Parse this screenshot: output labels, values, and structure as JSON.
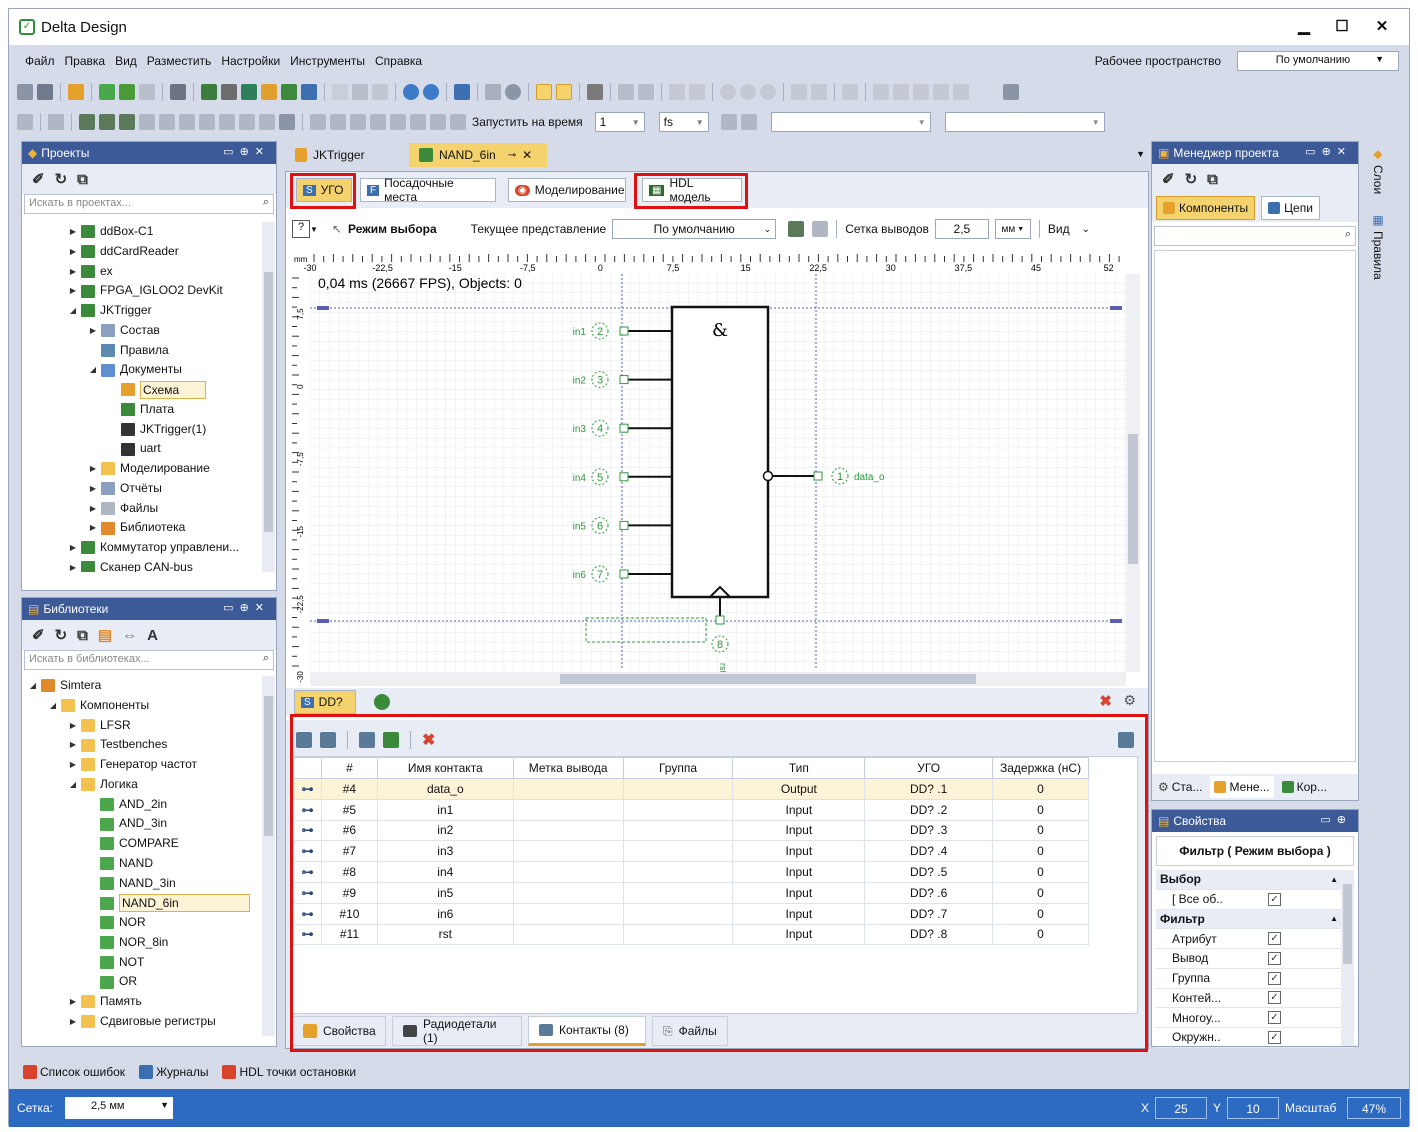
{
  "app": {
    "title": "Delta Design"
  },
  "menu": [
    "Файл",
    "Правка",
    "Вид",
    "Разместить",
    "Настройки",
    "Инструменты",
    "Справка"
  ],
  "workspace": {
    "label": "Рабочее пространство",
    "value": "По умолчанию"
  },
  "toolbar3": {
    "run_label": "Запустить на время",
    "run_value": "1",
    "run_unit": "fs"
  },
  "projects": {
    "title": "Проекты",
    "search_placeholder": "Искать в проектах...",
    "items": [
      "ddBox-C1",
      "ddCardReader",
      "ex",
      "FPGA_IGLOO2 DevKit",
      "JKTrigger",
      "Состав",
      "Правила",
      "Документы",
      "Схема",
      "Плата",
      "JKTrigger(1)",
      "uart",
      "Моделирование",
      "Отчёты",
      "Файлы",
      "Библиотека",
      "Коммутатор управлени...",
      "Сканер CAN-bus"
    ]
  },
  "libraries": {
    "title": "Библиотеки",
    "search_placeholder": "Искать в библиотеках...",
    "items": [
      "Simtera",
      "Компоненты",
      "LFSR",
      "Testbenches",
      "Генератор частот",
      "Логика",
      "AND_2in",
      "AND_3in",
      "COMPARE",
      "NAND",
      "NAND_3in",
      "NAND_6in",
      "NOR",
      "NOR_8in",
      "NOT",
      "OR",
      "Память",
      "Сдвиговые регистры"
    ]
  },
  "doc_tabs": {
    "tab1": "JKTrigger",
    "tab2": "NAND_6in"
  },
  "sub_tabs": {
    "ugo": "УГО",
    "pads": "Посадочные места",
    "sim": "Моделирование",
    "hdl": "HDL модель"
  },
  "view_toolbar": {
    "mode": "Режим выбора",
    "view_label": "Текущее представление",
    "view_value": "По умолчанию",
    "grid_label": "Сетка выводов",
    "grid_value": "2,5",
    "grid_unit": "мм",
    "vid": "Вид"
  },
  "canvas": {
    "fps": "0,04 ms (26667 FPS), Objects: 0",
    "ruler_unit": "mm",
    "ruler_top": [
      "-30",
      "-22,5",
      "-15",
      "-7,5",
      "0",
      "7,5",
      "15",
      "22,5",
      "30",
      "37,5",
      "45",
      "52"
    ],
    "ruler_left": [
      "7,5",
      "0",
      "-7,5",
      "-15",
      "-22,5",
      "-30"
    ],
    "gate_symbol": "&",
    "pins_in": [
      {
        "name": "in1",
        "num": "2"
      },
      {
        "name": "in2",
        "num": "3"
      },
      {
        "name": "in3",
        "num": "4"
      },
      {
        "name": "in4",
        "num": "5"
      },
      {
        "name": "in5",
        "num": "6"
      },
      {
        "name": "in6",
        "num": "7"
      }
    ],
    "pin_out": {
      "name": "data_o",
      "num": "1"
    },
    "pin_bottom": {
      "name": "rst",
      "num": "8"
    },
    "designator": "DD?"
  },
  "contacts": {
    "headers": [
      "#",
      "Имя контакта",
      "Метка вывода",
      "Группа",
      "Тип",
      "УГО",
      "Задержка (нС)"
    ],
    "rows": [
      {
        "n": "#4",
        "name": "data_o",
        "label": "",
        "group": "",
        "type": "Output",
        "ugo": "DD? .1",
        "delay": "0"
      },
      {
        "n": "#5",
        "name": "in1",
        "label": "",
        "group": "",
        "type": "Input",
        "ugo": "DD? .2",
        "delay": "0"
      },
      {
        "n": "#6",
        "name": "in2",
        "label": "",
        "group": "",
        "type": "Input",
        "ugo": "DD? .3",
        "delay": "0"
      },
      {
        "n": "#7",
        "name": "in3",
        "label": "",
        "group": "",
        "type": "Input",
        "ugo": "DD? .4",
        "delay": "0"
      },
      {
        "n": "#8",
        "name": "in4",
        "label": "",
        "group": "",
        "type": "Input",
        "ugo": "DD? .5",
        "delay": "0"
      },
      {
        "n": "#9",
        "name": "in5",
        "label": "",
        "group": "",
        "type": "Input",
        "ugo": "DD? .6",
        "delay": "0"
      },
      {
        "n": "#10",
        "name": "in6",
        "label": "",
        "group": "",
        "type": "Input",
        "ugo": "DD? .7",
        "delay": "0"
      },
      {
        "n": "#11",
        "name": "rst",
        "label": "",
        "group": "",
        "type": "Input",
        "ugo": "DD? .8",
        "delay": "0"
      }
    ],
    "tabs": [
      "Свойства",
      "Радиодетали (1)",
      "Контакты (8)",
      "Файлы"
    ]
  },
  "project_manager": {
    "title": "Менеджер проекта",
    "btn_components": "Компоненты",
    "btn_nets": "Цепи",
    "bottom_tabs": [
      "Ста...",
      "Мене...",
      "Кор..."
    ]
  },
  "properties": {
    "title": "Свойства",
    "filter_title": "Фильтр ( Режим выбора )",
    "section_select": "Выбор",
    "all_objects": "[ Все об..",
    "section_filter": "Фильтр",
    "filters": [
      "Атрибут",
      "Вывод",
      "Группа",
      "Контей...",
      "Многоу...",
      "Окружн.."
    ]
  },
  "side_tabs": [
    "Слои",
    "Правила"
  ],
  "bottom_tabs": [
    "Список ошибок",
    "Журналы",
    "HDL точки остановки"
  ],
  "statusbar": {
    "grid_label": "Сетка:",
    "grid_value": "2,5 мм",
    "x_label": "X",
    "x_value": "25",
    "y_label": "Y",
    "y_value": "10",
    "scale_label": "Масштаб",
    "scale_value": "47%"
  }
}
